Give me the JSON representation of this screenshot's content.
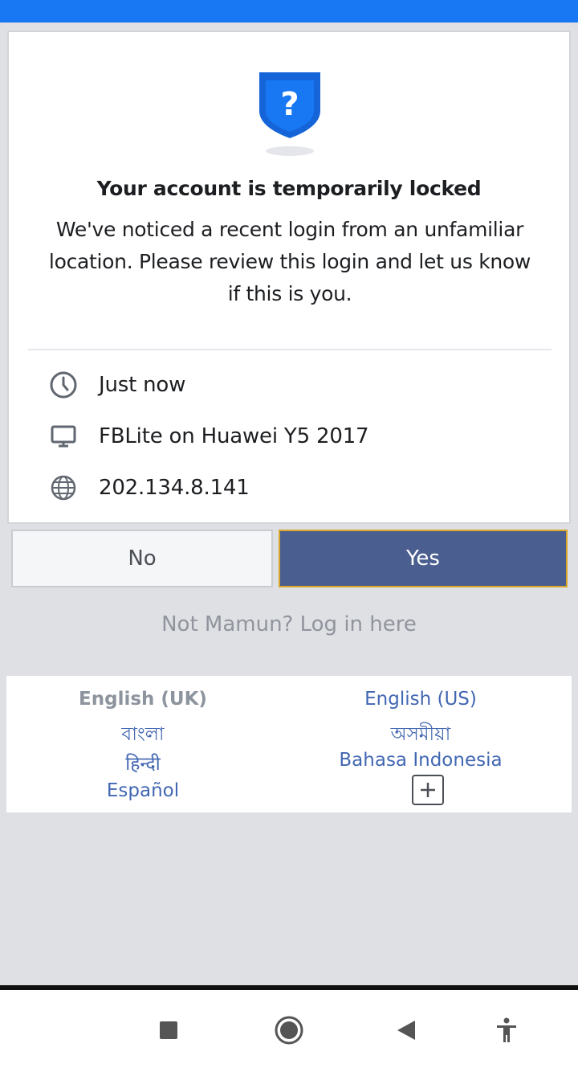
{
  "notice": {
    "title": "Your account is temporarily locked",
    "description": "We've noticed a recent login from an unfamiliar location. Please review this login and let us know if this is you.",
    "icon": "shield-question-icon"
  },
  "login_details": [
    {
      "icon": "clock-icon",
      "text": "Just now"
    },
    {
      "icon": "monitor-icon",
      "text": "FBLite on Huawei Y5 2017"
    },
    {
      "icon": "globe-icon",
      "text": "202.134.8.141"
    }
  ],
  "actions": {
    "no_label": "No",
    "yes_label": "Yes",
    "not_you_link": "Not Mamun? Log in here"
  },
  "languages": {
    "current": "English (UK)",
    "options": [
      "English (US)",
      "বাংলা",
      "অসমীয়া",
      "हिन्दी",
      "Bahasa Indonesia",
      "Español"
    ],
    "more_icon": "plus-icon"
  },
  "system_nav": {
    "recents_icon": "square-icon",
    "home_icon": "circle-icon",
    "back_icon": "triangle-back-icon",
    "accessibility_icon": "accessibility-icon"
  },
  "colors": {
    "status_bar": "#1877f2",
    "primary_button": "#4a5f8f",
    "link": "#4267b2"
  }
}
